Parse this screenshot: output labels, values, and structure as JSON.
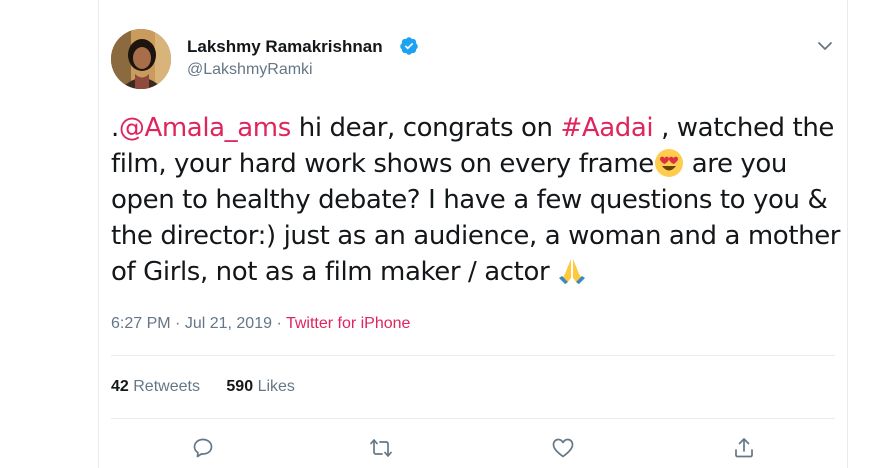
{
  "tweet": {
    "display_name": "Lakshmy Ramakrishnan",
    "handle": "@LakshmyRamki",
    "text_parts": {
      "dot": ".",
      "mention": "@Amala_ams",
      "t1": " hi dear, congrats on ",
      "hashtag": "#Aadai",
      "t2": " , watched the film, your hard work shows on every frame",
      "t3": " are you open to healthy debate? I have a few questions to you & the director:) just as an audience, a woman and a mother of Girls, not as a film maker / actor "
    },
    "time": "6:27 PM",
    "separator": " · ",
    "date": "Jul 21, 2019",
    "source": "Twitter for iPhone",
    "retweets_count": "42",
    "retweets_label": "Retweets",
    "likes_count": "590",
    "likes_label": "Likes"
  },
  "icons": {
    "verified": "verified-badge-icon",
    "caret": "chevron-down-icon",
    "emoji1": "heart-eyes-emoji",
    "emoji2": "folded-hands-emoji",
    "reply": "reply-icon",
    "retweet": "retweet-icon",
    "like": "heart-icon",
    "share": "share-icon"
  },
  "colors": {
    "link": "#e0245e",
    "secondary": "#657786",
    "verified": "#1da1f2",
    "text": "#14171a"
  }
}
